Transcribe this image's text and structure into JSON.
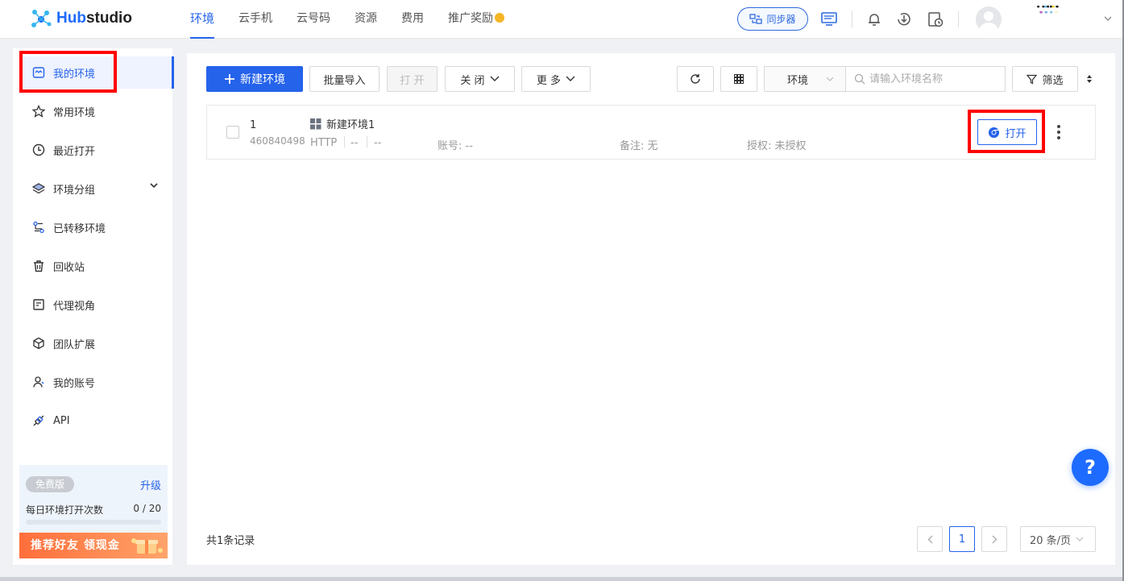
{
  "app": {
    "logo_prefix": "Hub",
    "logo_suffix": "studio"
  },
  "nav": {
    "items": [
      {
        "label": "环境",
        "active": true
      },
      {
        "label": "云手机"
      },
      {
        "label": "云号码"
      },
      {
        "label": "资源"
      },
      {
        "label": "费用"
      },
      {
        "label": "推广奖励"
      }
    ]
  },
  "header": {
    "sync_label": "同步器"
  },
  "sidebar": {
    "items": [
      {
        "label": "我的环境",
        "icon": "environment-icon",
        "active": true
      },
      {
        "label": "常用环境",
        "icon": "star-icon"
      },
      {
        "label": "最近打开",
        "icon": "clock-icon"
      },
      {
        "label": "环境分组",
        "icon": "layers-icon"
      },
      {
        "label": "已转移环境",
        "icon": "transfer-icon"
      },
      {
        "label": "回收站",
        "icon": "trash-icon"
      },
      {
        "label": "代理视角",
        "icon": "proxy-icon"
      },
      {
        "label": "团队扩展",
        "icon": "cube-icon"
      },
      {
        "label": "我的账号",
        "icon": "user-icon"
      },
      {
        "label": "API",
        "icon": "api-icon"
      }
    ],
    "plan": {
      "badge": "免费版",
      "upgrade": "升级",
      "daily_label": "每日环境打开次数",
      "daily_count": "0 / 20",
      "daily_used_fraction": 0,
      "promo": "推荐好友 领现金"
    }
  },
  "toolbar": {
    "new_env": "新建环境",
    "batch_import": "批量导入",
    "open": "打 开",
    "close": "关 闭",
    "more": "更 多",
    "env_filter": "环境",
    "search_placeholder": "请输入环境名称",
    "filter": "筛选"
  },
  "table": {
    "rows": [
      {
        "index": "1",
        "id": "460840498",
        "name": "新建环境1",
        "proxy_type": "HTTP",
        "proxy_a": "--",
        "proxy_b": "--",
        "account": "账号: --",
        "remark": "备注: 无",
        "auth": "授权: 未授权",
        "open_label": "打开"
      }
    ]
  },
  "footer": {
    "total": "共1条记录",
    "current_page": "1",
    "page_size": "20 条/页"
  },
  "help_label": "?",
  "colors": {
    "accent": "#2563eb",
    "highlight": "#ff0000"
  }
}
